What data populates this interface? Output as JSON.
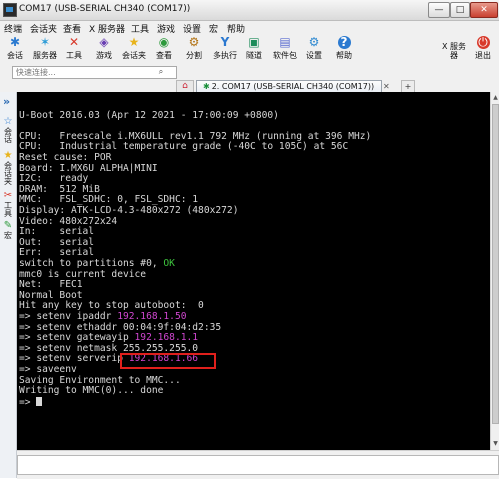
{
  "window": {
    "title": "COM17  (USB-SERIAL CH340 (COM17))",
    "btn_minimize": "—",
    "btn_maximize": "□",
    "btn_close": "✕"
  },
  "menu": [
    "终端",
    "会话夹",
    "查看",
    "X 服务器",
    "工具",
    "游戏",
    "设置",
    "宏",
    "帮助"
  ],
  "toolbar": {
    "items": [
      {
        "label": "会话",
        "icon": "session-icon",
        "glyph": "✱",
        "color": "#2b7ad0"
      },
      {
        "label": "服务器",
        "icon": "servers-icon",
        "glyph": "✶",
        "color": "#2b9bd6"
      },
      {
        "label": "工具",
        "icon": "tools-icon",
        "glyph": "✕",
        "color": "#d8392b"
      },
      {
        "label": "游戏",
        "icon": "games-icon",
        "glyph": "◈",
        "color": "#6a3fb3"
      },
      {
        "label": "会话夹",
        "icon": "bookmarks-icon",
        "glyph": "★",
        "color": "#e8b31a"
      },
      {
        "label": "查看",
        "icon": "view-icon",
        "glyph": "◉",
        "color": "#2d9a3c"
      },
      {
        "label": "分割",
        "icon": "split-icon",
        "glyph": "⚙",
        "color": "#b27212"
      },
      {
        "label": "多执行",
        "icon": "multiexec-icon",
        "glyph": "Y",
        "color": "#2b78d0"
      },
      {
        "label": "隧道",
        "icon": "tunneling-icon",
        "glyph": "▣",
        "color": "#1c8c5a"
      },
      {
        "label": "软件包",
        "icon": "packages-icon",
        "glyph": "▤",
        "color": "#5a6bd0"
      },
      {
        "label": "设置",
        "icon": "settings-icon",
        "glyph": "⚙",
        "color": "#2c88d0"
      },
      {
        "label": "帮助",
        "icon": "help-icon",
        "glyph": "?",
        "color": "#ffffff"
      }
    ],
    "xserver_label": "X 服务器",
    "exit_label": "退出"
  },
  "address": {
    "placeholder": "快速连接..."
  },
  "tab": {
    "label": "2. COM17  (USB-SERIAL CH340 (COM17))",
    "close": "✕"
  },
  "sidebar": {
    "items": [
      {
        "label": "会话",
        "glyph": "☆",
        "color": "#2b7ad0"
      },
      {
        "label": "会话夹",
        "glyph": "★",
        "color": "#e8b31a"
      },
      {
        "label": "工具",
        "glyph": "✂",
        "color": "#d8392b"
      },
      {
        "label": "宏",
        "glyph": "✎",
        "color": "#2d9a3c"
      }
    ]
  },
  "terminal": {
    "lines": [
      {
        "t": ""
      },
      {
        "t": "U-Boot 2016.03 (Apr 12 2021 - 17:00:09 +0800)"
      },
      {
        "t": ""
      },
      {
        "t": "CPU:   Freescale i.MX6ULL rev1.1 792 MHz (running at 396 MHz)"
      },
      {
        "t": "CPU:   Industrial temperature grade (-40C to 105C) at 56C"
      },
      {
        "t": "Reset cause: POR"
      },
      {
        "t": "Board: I.MX6U ALPHA|MINI"
      },
      {
        "t": "I2C:   ready"
      },
      {
        "t": "DRAM:  512 MiB"
      },
      {
        "t": "MMC:   FSL_SDHC: 0, FSL_SDHC: 1"
      },
      {
        "t": "Display: ATK-LCD-4.3-480x272 (480x272)"
      },
      {
        "t": "Video: 480x272x24"
      },
      {
        "t": "In:    serial"
      },
      {
        "t": "Out:   serial"
      },
      {
        "t": "Err:   serial"
      },
      {
        "t": "switch to partitions #0, ",
        "hl": "OK",
        "hc": "c-green"
      },
      {
        "t": "mmc0 is current device"
      },
      {
        "t": "Net:   FEC1"
      },
      {
        "t": "Normal Boot"
      },
      {
        "t": "Hit any key to stop autoboot:  0"
      },
      {
        "t": "=> setenv ipaddr ",
        "hl": "192.168.1.50",
        "hc": "c-mag"
      },
      {
        "t": "=> setenv ethaddr 00:04:9f:04:d2:35"
      },
      {
        "t": "=> setenv gatewayip ",
        "hl": "192.168.1.1",
        "hc": "c-mag"
      },
      {
        "t": "=> setenv netmask 255.255.255.0"
      },
      {
        "t": "=> setenv serverip ",
        "hl": "192.168.1.66",
        "hc": "c-mag"
      },
      {
        "t": "=> saveenv"
      },
      {
        "t": "Saving Environment to MMC..."
      },
      {
        "t": "Writing to MMC(0)... done"
      },
      {
        "t": "=> ",
        "cursor": true
      }
    ]
  }
}
